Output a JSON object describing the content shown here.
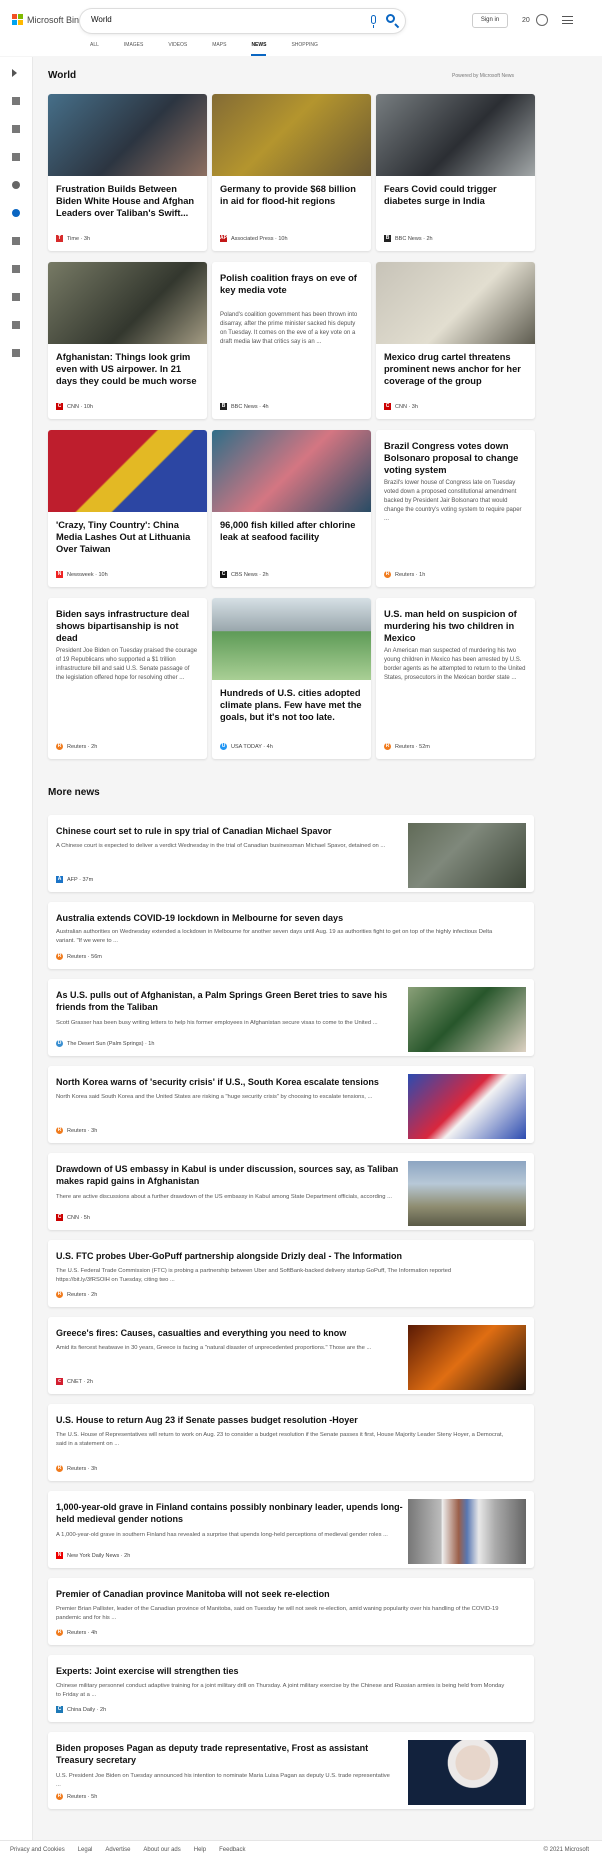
{
  "header": {
    "brand": "Microsoft Bing",
    "search_value": "World",
    "signin": "Sign in",
    "points": "20"
  },
  "tabs": [
    "ALL",
    "IMAGES",
    "VIDEOS",
    "MAPS",
    "NEWS",
    "SHOPPING"
  ],
  "colors": {
    "microsoft_red": "#f25022",
    "microsoft_green": "#7fba00",
    "microsoft_blue": "#00a4ef",
    "microsoft_yellow": "#ffb900",
    "accent": "#0a66c2"
  },
  "section": {
    "title": "World",
    "powered": "Powered by Microsoft News"
  },
  "cards": [
    {
      "title": "Frustration Builds Between Biden White House and Afghan Leaders over Taliban's Swift...",
      "source": "Time · 3h",
      "icon": "time-icon"
    },
    {
      "title": "Germany to provide $68 billion in aid for flood-hit regions",
      "source": "Associated Press · 10h",
      "icon": "ap-icon"
    },
    {
      "title": "Fears Covid could trigger diabetes surge in India",
      "source": "BBC News · 2h",
      "icon": "bbc-icon"
    },
    {
      "title": "Afghanistan: Things look grim even with US airpower. In 21 days they could be much worse",
      "source": "CNN · 10h",
      "icon": "cnn-icon"
    },
    {
      "title": "Polish coalition frays on eve of key media vote",
      "desc": "Poland's coalition government has been thrown into disarray, after the prime minister sacked his deputy on Tuesday. It comes on the eve of a key vote on a draft media law that critics say is an ...",
      "source": "BBC News · 4h",
      "icon": "bbc-icon"
    },
    {
      "title": "Mexico drug cartel threatens prominent news anchor for her coverage of the group",
      "source": "CNN · 3h",
      "icon": "cnn-icon"
    },
    {
      "title": "'Crazy, Tiny Country': China Media Lashes Out at Lithuania Over Taiwan",
      "source": "Newsweek · 10h",
      "icon": "newsweek-icon"
    },
    {
      "title": "96,000 fish killed after chlorine leak at seafood facility",
      "source": "CBS News · 2h",
      "icon": "cbs-icon"
    },
    {
      "title": "Brazil Congress votes down Bolsonaro proposal to change voting system",
      "desc": "Brazil's lower house of Congress late on Tuesday voted down a proposed constitutional amendment backed by President Jair Bolsonaro that would change the country's voting system to require paper ...",
      "source": "Reuters · 1h",
      "icon": "reuters-icon"
    },
    {
      "title": "Biden says infrastructure deal shows bipartisanship is not dead",
      "desc": "President Joe Biden on Tuesday praised the courage of 19 Republicans who supported a $1 trillion infrastructure bill and said U.S. Senate passage of the legislation offered hope for resolving other ...",
      "source": "Reuters · 2h",
      "icon": "reuters-icon"
    },
    {
      "title": "Hundreds of U.S. cities adopted climate plans. Few have met the goals, but it's not too late.",
      "source": "USA TODAY · 4h",
      "icon": "usatoday-icon"
    },
    {
      "title": "U.S. man held on suspicion of murdering his two children in Mexico",
      "desc": "An American man suspected of murdering his two young children in Mexico has been arrested by U.S. border agents as he attempted to return to the United States, prosecutors in the Mexican border state ...",
      "source": "Reuters · 52m",
      "icon": "reuters-icon"
    }
  ],
  "more_news": {
    "title": "More news",
    "items": [
      {
        "title": "Chinese court set to rule in spy trial of Canadian Michael Spavor",
        "desc": "A Chinese court is expected to deliver a verdict Wednesday in the trial of Canadian businessman Michael Spavor, detained on ...",
        "source": "AFP · 37m",
        "icon": "afp-icon"
      },
      {
        "title": "Australia extends COVID-19 lockdown in Melbourne for seven days",
        "desc": "Australian authorities on Wednesday extended a lockdown in Melbourne for another seven days until Aug. 19 as authorities fight to get on top of the highly infectious Delta variant. \"If we were to ...",
        "source": "Reuters · 56m",
        "icon": "reuters-icon"
      },
      {
        "title": "As U.S. pulls out of Afghanistan, a Palm Springs Green Beret tries to save his friends from the Taliban",
        "desc": "Scott Grasser has been busy writing letters to help his former employees in Afghanistan secure visas to come to the United ...",
        "source": "The Desert Sun (Palm Springs) · 1h",
        "icon": "desertsun-icon"
      },
      {
        "title": "North Korea warns of 'security crisis' if U.S., South Korea escalate tensions",
        "desc": "North Korea said South Korea and the United States are risking a \"huge security crisis\" by choosing to escalate tensions, ...",
        "source": "Reuters · 3h",
        "icon": "reuters-icon"
      },
      {
        "title": "Drawdown of US embassy in Kabul is under discussion, sources say, as Taliban makes rapid gains in Afghanistan",
        "desc": "There are active discussions about a further drawdown of the US embassy in Kabul among State Department officials, according ...",
        "source": "CNN · 5h",
        "icon": "cnn-icon"
      },
      {
        "title": "U.S. FTC probes Uber-GoPuff partnership alongside Drizly deal - The Information",
        "desc": "The U.S. Federal Trade Commission (FTC) is probing a partnership between Uber and SoftBank-backed delivery startup GoPuff, The Information reported https://bit.ly/3fRSOlH on Tuesday, citing two ...",
        "source": "Reuters · 2h",
        "icon": "reuters-icon"
      },
      {
        "title": "Greece's fires: Causes, casualties and everything you need to know",
        "desc": "Amid its fiercest heatwave in 30 years, Greece is facing a \"natural disaster of unprecedented proportions.\" Those are the ...",
        "source": "CNET · 2h",
        "icon": "cnet-icon"
      },
      {
        "title": "U.S. House to return Aug 23 if Senate passes budget resolution -Hoyer",
        "desc": "The U.S. House of Representatives will return to work on Aug. 23 to consider a budget resolution if the Senate passes it first, House Majority Leader Steny Hoyer, a Democrat, said in a statement on ...",
        "source": "Reuters · 3h",
        "icon": "reuters-icon"
      },
      {
        "title": "1,000-year-old grave in Finland contains possibly nonbinary leader, upends long-held medieval gender notions",
        "desc": "A 1,000-year-old grave in southern Finland has revealed a surprise that upends long-held perceptions of medieval gender roles ...",
        "source": "New York Daily News · 2h",
        "icon": "nydn-icon"
      },
      {
        "title": "Premier of Canadian province Manitoba will not seek re-election",
        "desc": "Premier Brian Pallister, leader of the Canadian province of Manitoba, said on Tuesday he will not seek re-election, amid waning popularity over his handling of the COVID-19 pandemic and for his ...",
        "source": "Reuters · 4h",
        "icon": "reuters-icon"
      },
      {
        "title": "Experts: Joint exercise will strengthen ties",
        "desc": "Chinese military personnel conduct adaptive training for a joint military drill on Thursday. A joint military exercise by the Chinese and Russian armies is being held from Monday to Friday at a ...",
        "source": "China Daily · 2h",
        "icon": "chinadaily-icon"
      },
      {
        "title": "Biden proposes Pagan as deputy trade representative, Frost as assistant Treasury secretary",
        "desc": "U.S. President Joe Biden on Tuesday announced his intention to nominate Maria Luisa Pagan as deputy U.S. trade representative ...",
        "source": "Reuters · 5h",
        "icon": "reuters-icon"
      }
    ]
  },
  "footer": {
    "links": [
      "Privacy and Cookies",
      "Legal",
      "Advertise",
      "About our ads",
      "Help",
      "Feedback"
    ],
    "copyright": "© 2021 Microsoft"
  }
}
